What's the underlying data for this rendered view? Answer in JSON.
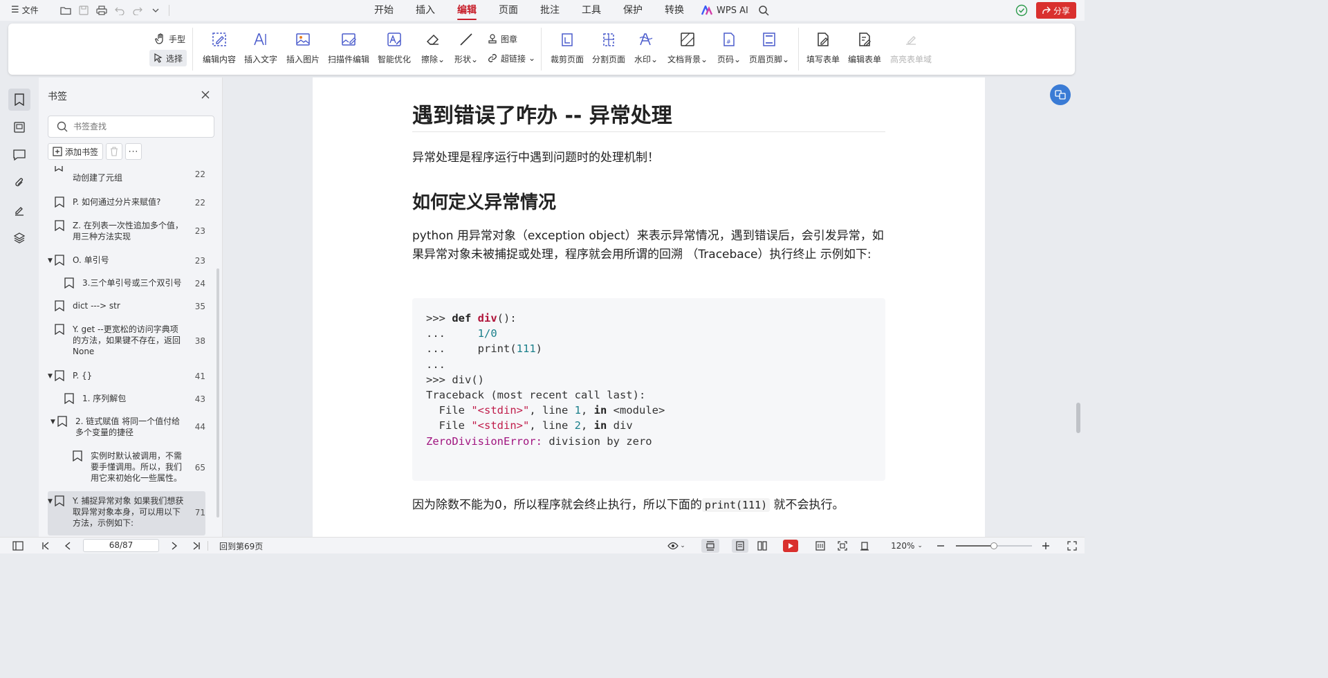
{
  "topbar": {
    "menu_label": "文件",
    "tabs": [
      "开始",
      "插入",
      "编辑",
      "页面",
      "批注",
      "工具",
      "保护",
      "转换"
    ],
    "active_tab": "编辑",
    "wps_ai": "WPS AI",
    "share_label": "分享"
  },
  "ribbon": {
    "hand": "手型",
    "select": "选择",
    "edit_content": "编辑内容",
    "insert_text": "插入文字",
    "insert_image": "插入图片",
    "scan_edit": "扫描件编辑",
    "smart_optimize": "智能优化",
    "erase": "擦除",
    "shape": "形状",
    "stamp": "图章",
    "hyperlink": "超链接",
    "crop_page": "裁剪页面",
    "split_page": "分割页面",
    "watermark": "水印",
    "doc_background": "文档背景",
    "page_number": "页码",
    "header_footer": "页眉页脚",
    "fill_form": "填写表单",
    "edit_form": "编辑表单",
    "highlight_field": "高亮表单域"
  },
  "bookmarks": {
    "title": "书签",
    "search_placeholder": "书签查找",
    "add_label": "添加书签",
    "items": [
      {
        "text": "动创建了元组",
        "page": "22"
      },
      {
        "text": "P. 如何通过分片来赋值?",
        "page": "22"
      },
      {
        "text": "Z. 在列表一次性追加多个值，用三种方法实现",
        "page": "23"
      },
      {
        "text": "O. 单引号",
        "page": "23"
      },
      {
        "text": "3.三个单引号或三个双引号",
        "page": "24"
      },
      {
        "text": "dict ---> str",
        "page": "35"
      },
      {
        "text": "Y. get --更宽松的访问字典项的方法，如果键不存在，返回None",
        "page": "38"
      },
      {
        "text": "P. {}",
        "page": "41"
      },
      {
        "text": "1. 序列解包",
        "page": "43"
      },
      {
        "text": "2. 链式赋值 将同一个值付给多个变量的捷径",
        "page": "44"
      },
      {
        "text": "实例时默认被调用，不需要手懂调用。所以，我们用它来初始化一些属性。",
        "page": "65"
      },
      {
        "text": "Y. 捕捉异常对象 如果我们想获取异常对象本身，可以用以下方法，示例如下:",
        "page": "71"
      }
    ]
  },
  "document": {
    "h1": "遇到错误了咋办 -- 异常处理",
    "intro": "异常处理是程序运行中遇到问题时的处理机制！",
    "h2": "如何定义异常情况",
    "para": "python 用异常对象（exception object）来表示异常情况，遇到错误后，会引发异常，如果异常对象未被捕捉或处理，程序就会用所谓的回溯 （Tracebace）执行终止 示例如下:",
    "code": {
      "l1_prompt": ">>> ",
      "l1_kw": "def",
      "l1_fn": "div",
      "l1_rest": "():",
      "l2_prompt": "...     ",
      "l2_num1": "1",
      "l2_op": "/",
      "l2_num2": "0",
      "l3_prompt": "...     ",
      "l3_call": "print(",
      "l3_num": "111",
      "l3_close": ")",
      "l4_prompt": "...",
      "l5": ">>> div()",
      "l6": "Traceback (most recent call last):",
      "l7_pre": "  File ",
      "l7_str": "\"<stdin>\"",
      "l7_mid": ", line ",
      "l7_num": "1",
      "l7_sep": ", ",
      "l7_kw": "in",
      "l7_end": " <module>",
      "l8_pre": "  File ",
      "l8_str": "\"<stdin>\"",
      "l8_mid": ", line ",
      "l8_num": "2",
      "l8_sep": ", ",
      "l8_kw": "in",
      "l8_end": " div",
      "l9_err": "ZeroDivisionError:",
      "l9_rest": " division by zero"
    },
    "outro_pre": "因为除数不能为0，所以程序就会终止执行，所以下面的",
    "outro_code": "print(111)",
    "outro_post": "就不会执行。"
  },
  "status": {
    "page_value": "68/87",
    "back_label": "回到第69页",
    "zoom": "120%"
  },
  "colors": {
    "accent": "#c71e2a",
    "share_bg": "#d9302e"
  }
}
